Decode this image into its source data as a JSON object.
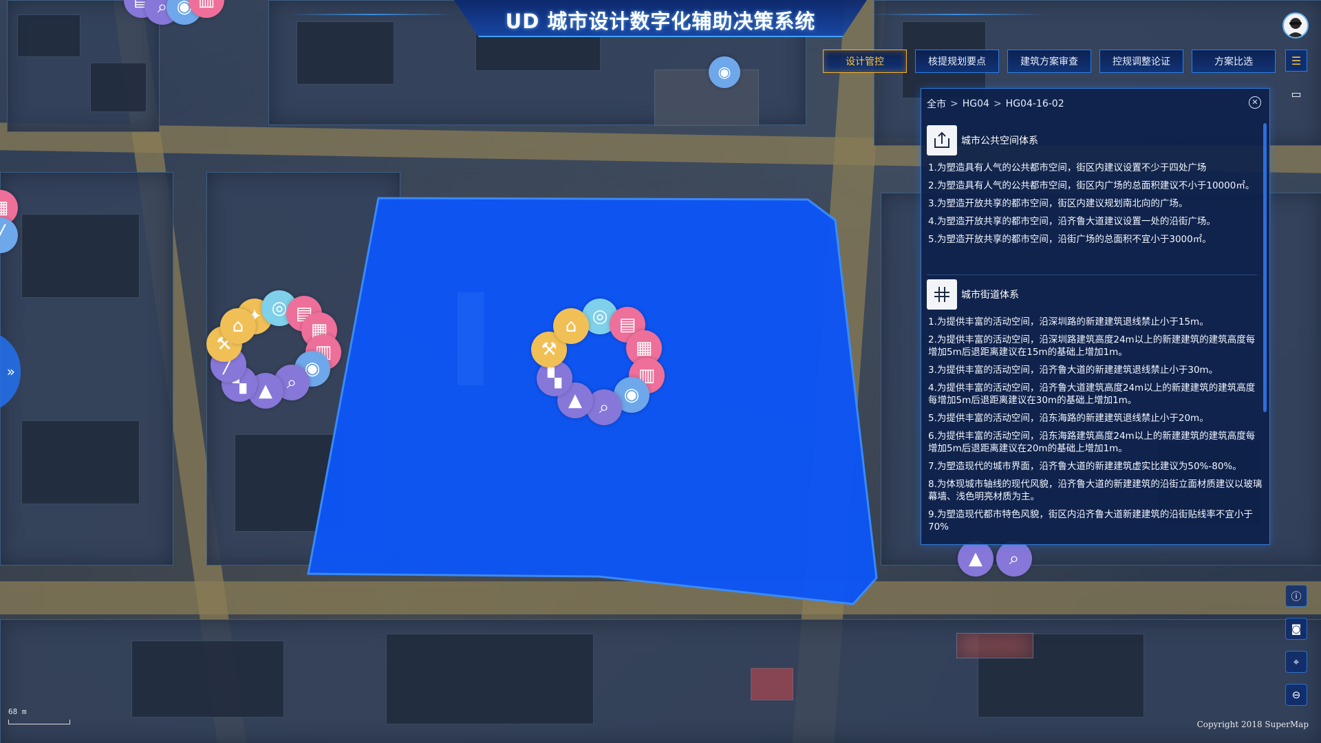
{
  "header": {
    "title": "UD 城市设计数字化辅助决策系统"
  },
  "nav": {
    "tabs": [
      {
        "label": "设计管控",
        "active": true
      },
      {
        "label": "核提规划要点",
        "active": false
      },
      {
        "label": "建筑方案审查",
        "active": false
      },
      {
        "label": "控规调整论证",
        "active": false
      },
      {
        "label": "方案比选",
        "active": false
      }
    ],
    "menu_icon": "list-icon",
    "accent_color": "#ffc637"
  },
  "panel": {
    "breadcrumb": [
      "全市",
      "HG04",
      "HG04-16-02"
    ],
    "sections": [
      {
        "title": "城市公共空间体系",
        "icon": "public-space-icon",
        "items": [
          "1.为塑造具有人气的公共都市空间，街区内建议设置不少于四处广场",
          "2.为塑造具有人气的公共都市空间，街区内广场的总面积建议不小于10000㎡。",
          "3.为塑造开放共享的都市空间，街区内建议规划南北向的广场。",
          "4.为塑造开放共享的都市空间，沿齐鲁大道建议设置一处的沿街广场。",
          "5.为塑造开放共享的都市空间，沿街广场的总面积不宜小于3000㎡。"
        ]
      },
      {
        "title": "城市街道体系",
        "icon": "street-system-icon",
        "items": [
          "1.为提供丰富的活动空间，沿深圳路的新建建筑退线禁止小于15m。",
          "2.为提供丰富的活动空间，沿深圳路建筑高度24m以上的新建建筑的建筑高度每增加5m后退距离建议在15m的基础上增加1m。",
          "3.为提供丰富的活动空间，沿齐鲁大道的新建建筑退线禁止小于30m。",
          "4.为提供丰富的活动空间，沿齐鲁大道建筑高度24m以上的新建建筑的建筑高度每增加5m后退距离建议在30m的基础上增加1m。",
          "5.为提供丰富的活动空间，沿东海路的新建建筑退线禁止小于20m。",
          "6.为提供丰富的活动空间，沿东海路建筑高度24m以上的新建建筑的建筑高度每增加5m后退距离建议在20m的基础上增加1m。",
          "7.为塑造现代的城市界面，沿齐鲁大道的新建建筑虚实比建议为50%-80%。",
          "8.为体现城市轴线的现代风貌，沿齐鲁大道的新建建筑的沿街立面材质建议以玻璃幕墙、浅色明亮材质为主。",
          "9.为塑造现代都市特色风貌，街区内沿齐鲁大道新建建筑的沿街贴线率不宜小于70%"
        ]
      }
    ]
  },
  "map": {
    "plot_color": "#0d55f5",
    "scale_label": "68 m",
    "copyright": "Copyright 2018 SuperMap"
  },
  "tools": [
    "info-icon",
    "camera-icon",
    "locate-icon",
    "toggle-icon"
  ]
}
